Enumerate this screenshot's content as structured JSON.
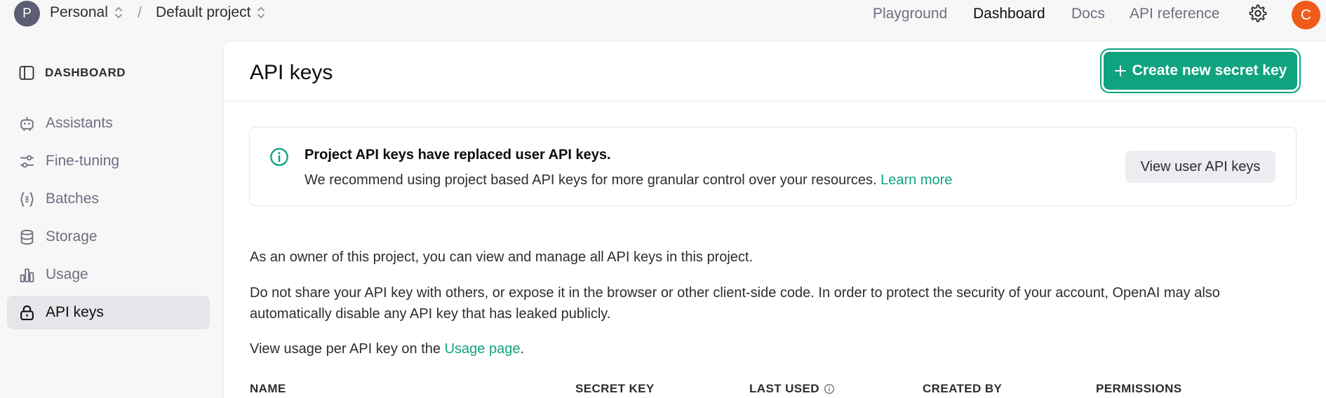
{
  "topbar": {
    "org_initial": "P",
    "org_name": "Personal",
    "separator": "/",
    "project_name": "Default project",
    "nav": [
      "Playground",
      "Dashboard",
      "Docs",
      "API reference"
    ],
    "active_nav": "Dashboard",
    "user_initial": "C"
  },
  "sidebar": {
    "header": "DASHBOARD",
    "items": [
      {
        "label": "Assistants",
        "icon": "robot-icon"
      },
      {
        "label": "Fine-tuning",
        "icon": "sliders-icon"
      },
      {
        "label": "Batches",
        "icon": "braces-icon"
      },
      {
        "label": "Storage",
        "icon": "database-icon"
      },
      {
        "label": "Usage",
        "icon": "bar-chart-icon"
      },
      {
        "label": "API keys",
        "icon": "lock-icon"
      }
    ],
    "active_item": "API keys"
  },
  "main": {
    "title": "API keys",
    "create_button": "Create new secret key",
    "notice": {
      "title": "Project API keys have replaced user API keys.",
      "body": "We recommend using project based API keys for more granular control over your resources.",
      "link": "Learn more",
      "button": "View user API keys"
    },
    "para1": "As an owner of this project, you can view and manage all API keys in this project.",
    "para2": "Do not share your API key with others, or expose it in the browser or other client-side code. In order to protect the security of your account, OpenAI may also automatically disable any API key that has leaked publicly.",
    "para3_prefix": "View usage per API key on the",
    "para3_link": "Usage page",
    "para3_suffix": ".",
    "table_headers": [
      "NAME",
      "SECRET KEY",
      "LAST USED",
      "CREATED BY",
      "PERMISSIONS"
    ]
  },
  "colors": {
    "accent": "#10a37f",
    "user_avatar": "#f05a1a",
    "org_avatar": "#5d5d73"
  }
}
